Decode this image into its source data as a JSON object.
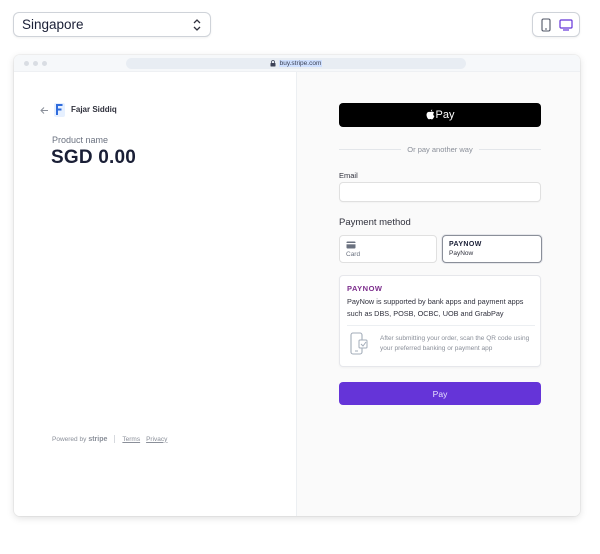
{
  "controls": {
    "country": "Singapore",
    "device_modes": [
      {
        "name": "mobile-icon",
        "active": false
      },
      {
        "name": "desktop-icon",
        "active": true
      }
    ]
  },
  "browser": {
    "url": "buy.stripe.com"
  },
  "merchant": {
    "name": "Fajar Siddiq"
  },
  "product": {
    "name": "Product name",
    "price": "SGD 0.00"
  },
  "footer": {
    "powered_by": "Powered by",
    "brand": "stripe",
    "terms": "Terms",
    "privacy": "Privacy"
  },
  "checkout": {
    "apple_pay_label": "Pay",
    "or_text": "Or pay another way",
    "email_label": "Email",
    "email_value": "",
    "payment_method_label": "Payment method",
    "methods": [
      {
        "label": "Card",
        "icon": "card-icon",
        "selected": false
      },
      {
        "logo": "PAYNOW",
        "label": "PayNow",
        "selected": true
      }
    ],
    "paynow": {
      "brand": "PAYNOW",
      "description": "PayNow is supported by bank apps and payment apps such as DBS, POSB, OCBC, UOB and GrabPay",
      "instruction": "After submitting your order, scan the QR code using your preferred banking or payment app"
    },
    "pay_button": "Pay"
  },
  "colors": {
    "accent": "#6534d8",
    "paynow_brand": "#7c2d8c"
  }
}
